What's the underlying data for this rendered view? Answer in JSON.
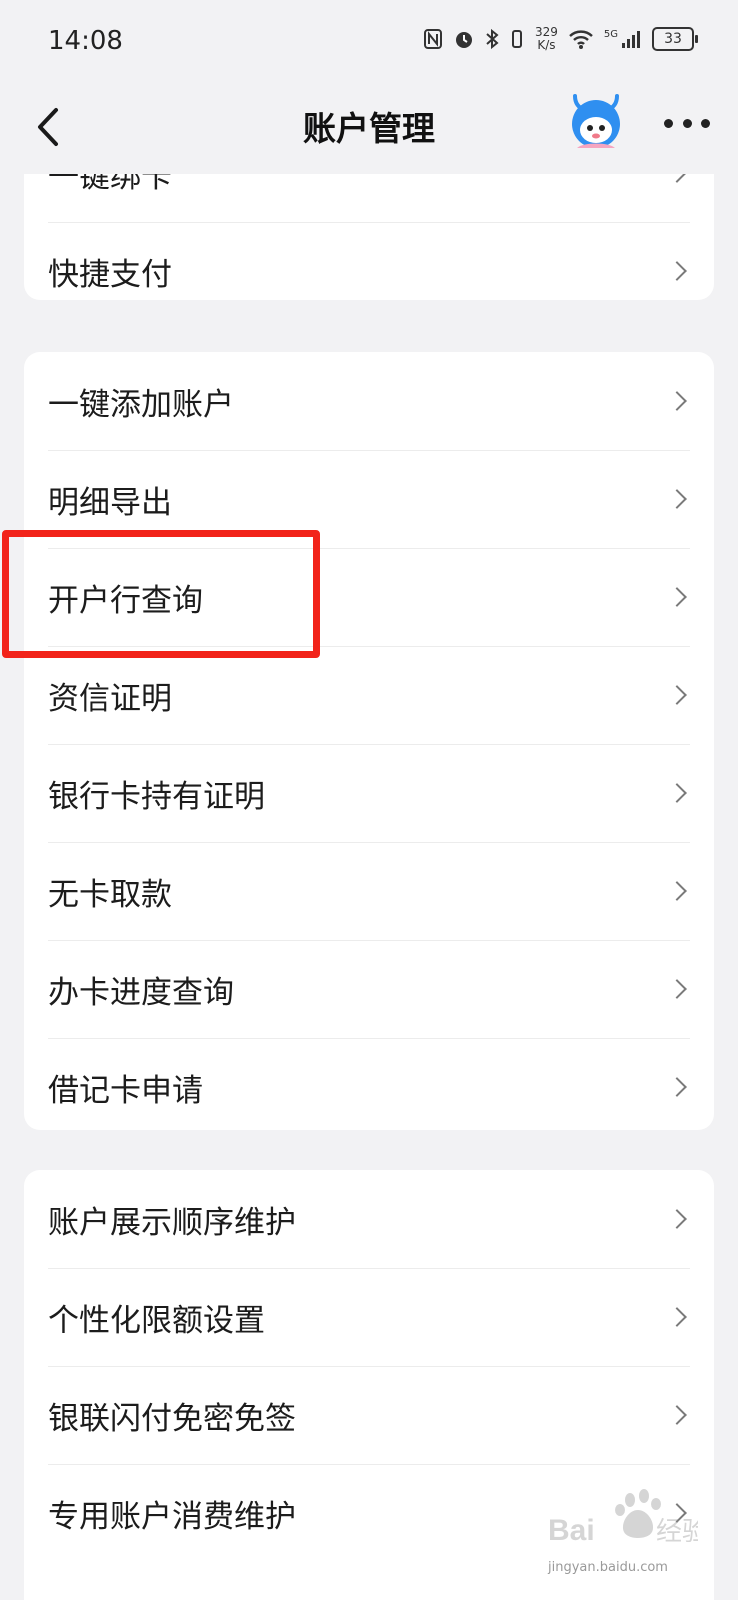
{
  "status_bar": {
    "time": "14:08",
    "net_speed_value": "329",
    "net_speed_unit": "K/s",
    "network": "5G",
    "battery": "33"
  },
  "header": {
    "title": "账户管理",
    "back_icon": "chevron-left-icon",
    "more_icon": "more-dots-icon"
  },
  "groups": [
    {
      "items": [
        {
          "label": "一键绑卡"
        },
        {
          "label": "快捷支付"
        }
      ]
    },
    {
      "items": [
        {
          "label": "一键添加账户"
        },
        {
          "label": "明细导出"
        },
        {
          "label": "开户行查询"
        },
        {
          "label": "资信证明"
        },
        {
          "label": "银行卡持有证明"
        },
        {
          "label": "无卡取款"
        },
        {
          "label": "办卡进度查询"
        },
        {
          "label": "借记卡申请"
        }
      ]
    },
    {
      "items": [
        {
          "label": "账户展示顺序维护"
        },
        {
          "label": "个性化限额设置"
        },
        {
          "label": "银联闪付免密免签"
        },
        {
          "label": "专用账户消费维护"
        }
      ]
    }
  ],
  "highlight": {
    "target": "开户行查询",
    "color": "#f2231a"
  },
  "watermark": {
    "text": "jingyan.baidu.com"
  },
  "colors": {
    "background": "#f2f2f4",
    "card": "#ffffff",
    "chevron": "#7a7a7a"
  }
}
